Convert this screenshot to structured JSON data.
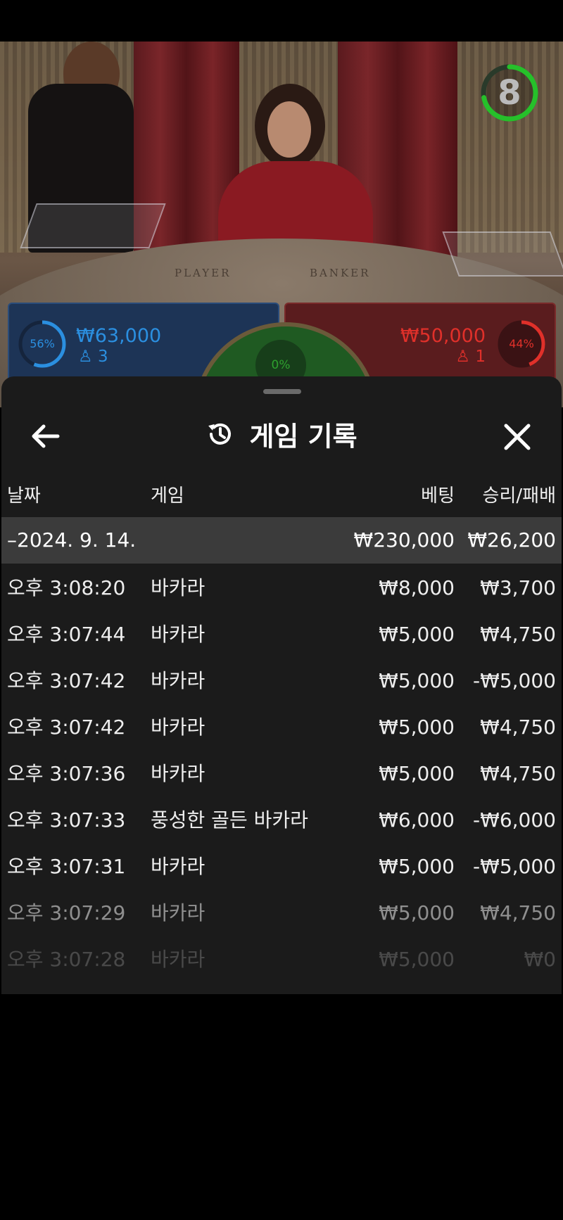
{
  "countdown": {
    "value": "8",
    "remaining_fraction": 0.72
  },
  "table_labels": {
    "player": "PLAYER",
    "banker": "BANKER"
  },
  "player_bets": {
    "percent": "56%",
    "percent_value": 0.56,
    "amount": "₩63,000",
    "players": "3",
    "color": "#2b8fe0"
  },
  "banker_bets": {
    "percent": "44%",
    "percent_value": 0.44,
    "amount": "₩50,000",
    "players": "1",
    "color": "#e0302a"
  },
  "tie_bets": {
    "percent": "0%"
  },
  "history": {
    "title": "게임 기록",
    "icons": {
      "back": "arrow-left-icon",
      "title": "history-icon",
      "close": "close-icon"
    },
    "columns": {
      "date": "날짜",
      "game": "게임",
      "bet": "베팅",
      "result": "승리/패배"
    },
    "date_group": {
      "toggle": "–",
      "date": "2024. 9. 14.",
      "bet_total": "₩230,000",
      "result_total": "₩26,200"
    },
    "rows": [
      {
        "time": "오후 3:08:20",
        "game": "바카라",
        "bet": "₩8,000",
        "result": "₩3,700"
      },
      {
        "time": "오후 3:07:44",
        "game": "바카라",
        "bet": "₩5,000",
        "result": "₩4,750"
      },
      {
        "time": "오후 3:07:42",
        "game": "바카라",
        "bet": "₩5,000",
        "result": "-₩5,000"
      },
      {
        "time": "오후 3:07:42",
        "game": "바카라",
        "bet": "₩5,000",
        "result": "₩4,750"
      },
      {
        "time": "오후 3:07:36",
        "game": "바카라",
        "bet": "₩5,000",
        "result": "₩4,750"
      },
      {
        "time": "오후 3:07:33",
        "game": "풍성한 골든 바카라",
        "bet": "₩6,000",
        "result": "-₩6,000"
      },
      {
        "time": "오후 3:07:31",
        "game": "바카라",
        "bet": "₩5,000",
        "result": "-₩5,000"
      },
      {
        "time": "오후 3:07:29",
        "game": "바카라",
        "bet": "₩5,000",
        "result": "₩4,750"
      },
      {
        "time": "오후 3:07:28",
        "game": "바카라",
        "bet": "₩5,000",
        "result": "₩0"
      }
    ]
  }
}
